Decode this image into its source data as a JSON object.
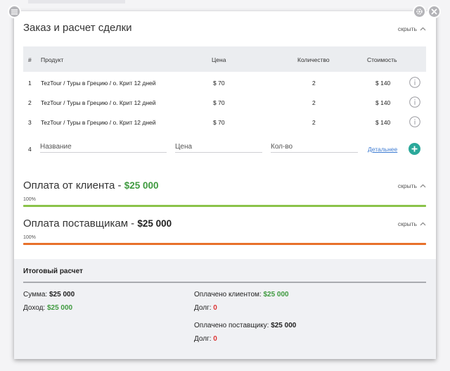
{
  "order": {
    "title": "Заказ и расчет сделки",
    "collapse_label": "скрыть",
    "columns": {
      "num": "#",
      "product": "Продукт",
      "price": "Цена",
      "qty": "Количество",
      "cost": "Стоимость"
    },
    "rows": [
      {
        "num": "1",
        "product": "TezTour / Туры в Грецию / о. Крит 12 дней",
        "price": "$ 70",
        "qty": "2",
        "cost": "$ 140"
      },
      {
        "num": "2",
        "product": "TezTour / Туры в Грецию / о. Крит 12 дней",
        "price": "$ 70",
        "qty": "2",
        "cost": "$ 140"
      },
      {
        "num": "3",
        "product": "TezTour / Туры в Грецию / о. Крит 12 дней",
        "price": "$ 70",
        "qty": "2",
        "cost": "$ 140"
      }
    ],
    "new_row": {
      "num": "4",
      "name_placeholder": "Название",
      "price_placeholder": "Цена",
      "qty_placeholder": "Кол-во",
      "details_label": "Детальнее"
    }
  },
  "client_payment": {
    "title": "Оплата от клиента - ",
    "amount": "$25 000",
    "collapse_label": "скрыть",
    "percent_label": "100%",
    "progress": 1.0,
    "color": "#8bc34a"
  },
  "supplier_payment": {
    "title": "Оплата поставщикам - ",
    "amount": "$25 000",
    "collapse_label": "скрыть",
    "percent_label": "100%",
    "progress": 1.0,
    "color": "#e8712b"
  },
  "summary": {
    "title": "Итоговый расчет",
    "sum_label": "Сумма: ",
    "sum_value": "$25 000",
    "income_label": "Доход: ",
    "income_value": "$25 000",
    "paid_client_label": "Оплачено клиентом: ",
    "paid_client_value": "$25 000",
    "debt_label": "Долг: ",
    "debt_client_value": "0",
    "paid_supplier_label": "Оплачено поставщику: ",
    "paid_supplier_value": "$25 000",
    "debt_supplier_value": "0"
  },
  "icons": {
    "menu": "menu-icon",
    "settings": "gear-icon",
    "close": "close-icon",
    "info": "info-icon",
    "add": "plus-icon",
    "chevron": "chevron-up-icon"
  }
}
